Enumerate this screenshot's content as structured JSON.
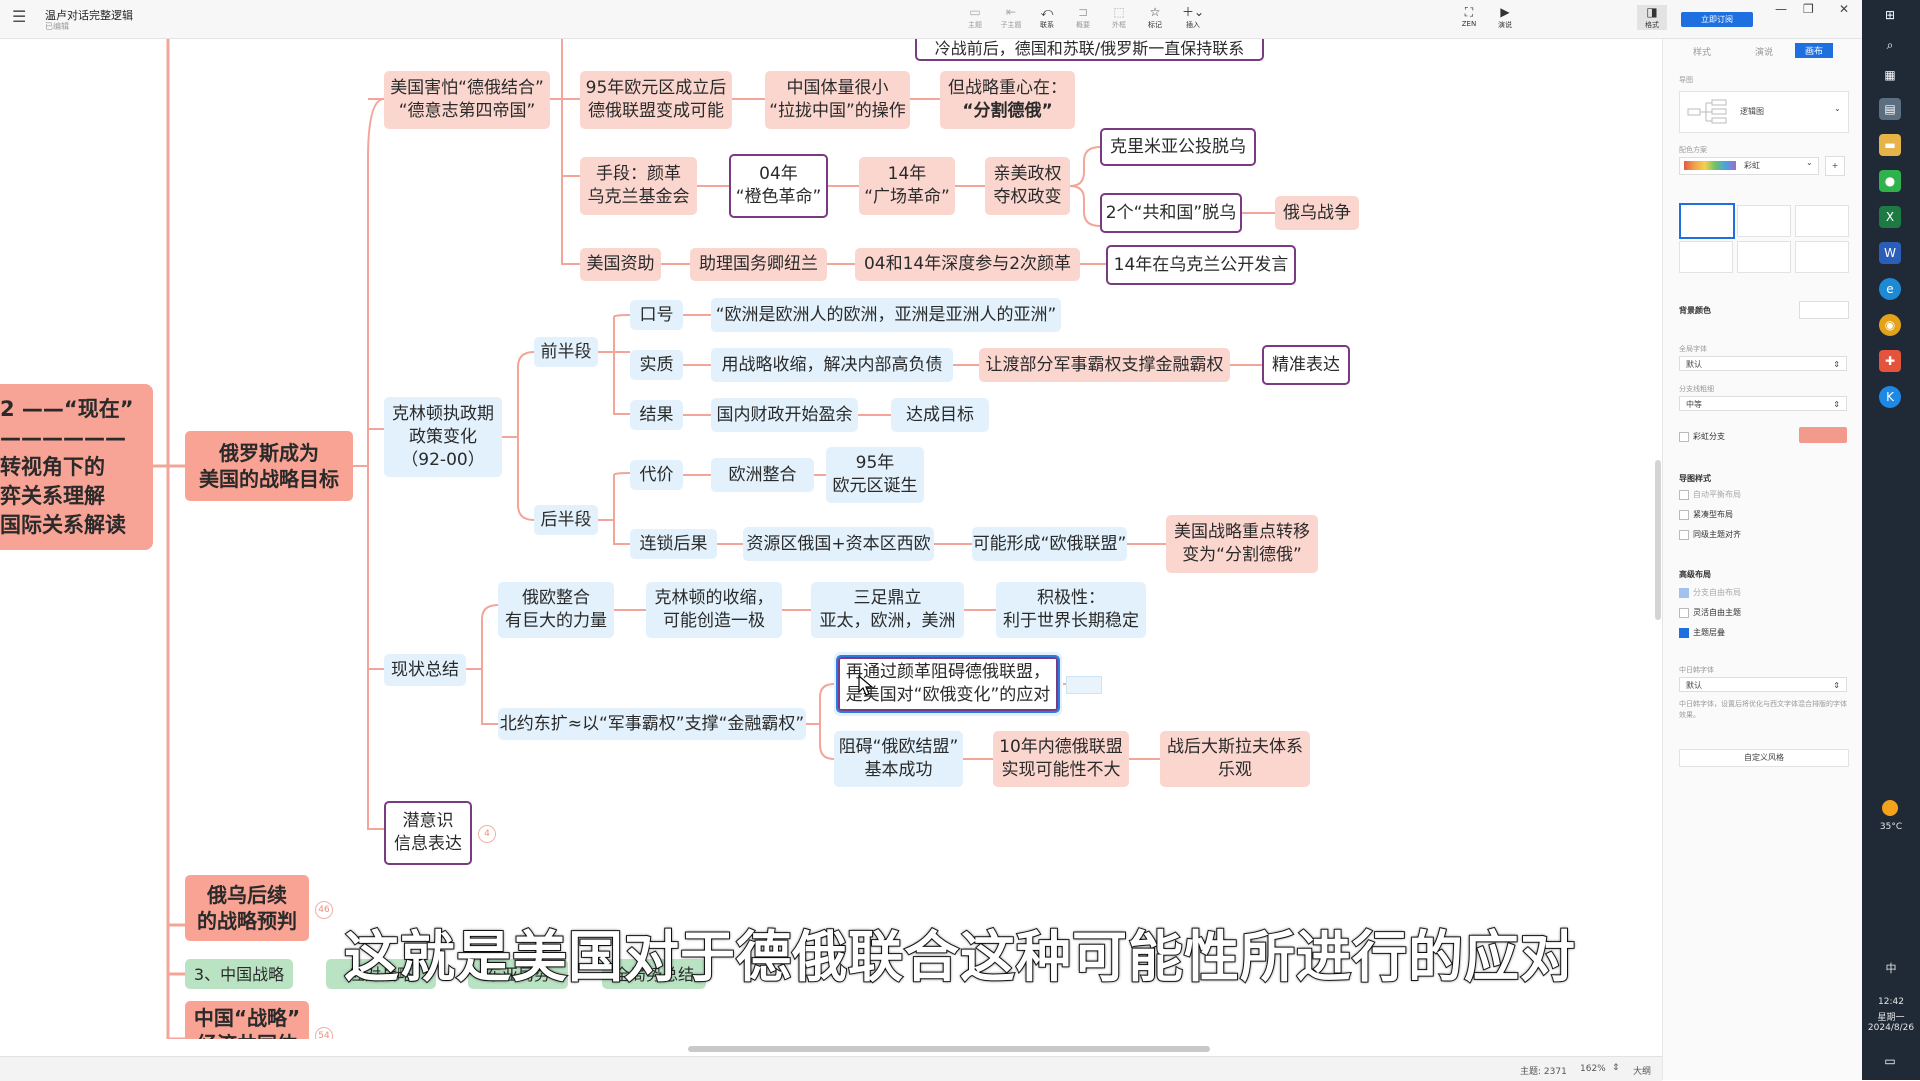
{
  "app": {
    "doc_title": "温卢对话完整逻辑",
    "doc_subtitle": "已编辑",
    "menu_icon": "menu-icon",
    "subscribe_label": "立即订阅"
  },
  "toolbar": {
    "items": [
      {
        "label": "主题",
        "icon": "topic-icon"
      },
      {
        "label": "子主题",
        "icon": "subtopic-icon"
      },
      {
        "label": "联系",
        "icon": "relation-icon"
      },
      {
        "label": "概要",
        "icon": "summary-icon"
      },
      {
        "label": "外框",
        "icon": "boundary-icon"
      },
      {
        "label": "标记",
        "icon": "star-icon"
      },
      {
        "label": "插入",
        "icon": "plus-icon"
      }
    ],
    "zen_label": "ZEN",
    "present_label": "演说",
    "format_label": "格式"
  },
  "mindmap": {
    "root_text": "2 ——“现在”\n——————\n转视角下的\n弈关系理解\n国际关系解读",
    "main_topic": "俄罗斯成为\n美国的战略目标",
    "top_partial": "冷战前后，德国和苏联/俄罗斯一直保持联系",
    "fear_topic": "美国害怕“德俄结合”\n“德意志第四帝国”",
    "euro_node": "95年欧元区成立后\n德俄联盟变成可能",
    "china_node": "中国体量很小\n“拉拢中国”的操作",
    "strategy_line1": "但战略重心在：",
    "strategy_line2": "“分割德俄”",
    "means_node": "手段：颜革\n乌克兰基金会",
    "orange_rev": "04年\n“橙色革命”",
    "square_rev": "14年\n“广场革命”",
    "pro_us": "亲美政权\n夺权政变",
    "crimea": "克里米亚公投脱乌",
    "two_republics": "2个“共和国”脱乌",
    "ru_ua_war": "俄乌战争",
    "us_funding": "美国资助",
    "nuland": "助理国务卿纽兰",
    "deep_involve": "04和14年深度参与2次颜革",
    "speech_ua": "14年在乌克兰公开发言",
    "clinton": "克林顿执政期\n政策变化\n（92-00）",
    "first_half": "前半段",
    "slogan": "口号",
    "slogan_text": "“欧洲是欧洲人的欧洲，亚洲是亚洲人的亚洲”",
    "essence": "实质",
    "essence_text": "用战略收缩，解决内部高负债",
    "yield_text": "让渡部分军事霸权支撑金融霸权",
    "precise": "精准表达",
    "result": "结果",
    "surplus": "国内财政开始盈余",
    "goal_met": "达成目标",
    "second_half": "后半段",
    "cost": "代价",
    "eu_integ": "欧洲整合",
    "euro_born": "95年\n欧元区诞生",
    "chain": "连锁后果",
    "resource": "资源区俄国+资本区西欧",
    "possible_union": "可能形成“欧俄联盟”",
    "shift": "美国战略重点转移\n变为“分割德俄”",
    "status": "现状总结",
    "ru_eu": "俄欧整合\n有巨大的力量",
    "clinton_shrink": "克林顿的收缩，\n可能创造一极",
    "tripod": "三足鼎立\n亚太，欧洲，美洲",
    "positive": "积极性：\n利于世界长期稳定",
    "nato": "北约东扩≈以“军事霸权”支撑“金融霸权”",
    "selected": "再通过颜革阻碍德俄联盟，\n是美国对“欧俄变化”的应对",
    "block": "阻碍“俄欧结盟”\n基本成功",
    "ten_years": "10年内德俄联盟\n实现可能性不大",
    "lavrov": "战后大斯拉夫体系\n乐观",
    "subconscious": "潜意识\n信息表达",
    "count_4": "4",
    "ru_ua_follow": "俄乌后续\n的战略预判",
    "count_46": "46",
    "china_strategy3": "3、中国战略",
    "green_a": "应对战略",
    "green_b": "东亚局势",
    "green_c": "全局势总结",
    "china_war": "中国“战略”\n经济共同体",
    "count_54": "54"
  },
  "subtitle": "这就是美国对于德俄联合这种可能性所进行的应对",
  "statusbar": {
    "topic_count": "主题: 2371",
    "zoom": "162%",
    "outline": "大纲"
  },
  "panel": {
    "tabs": [
      "样式",
      "演说",
      "画布"
    ],
    "structure_label": "导图",
    "structure_value": "逻辑图",
    "color_label": "配色方案",
    "color_value": "彩虹",
    "bg_label": "背景颜色",
    "font_label": "全局字体",
    "font_value": "默认",
    "branch_label": "分支线粗细",
    "branch_value": "中等",
    "rainbow_label": "彩虹分支",
    "map_style_label": "导图样式",
    "opt_auto": "自动平衡布局",
    "opt_compact": "紧凑型布局",
    "opt_align": "同级主题对齐",
    "adv_label": "高级布局",
    "opt_free_branch": "分支自由布局",
    "opt_free_topic": "灵活自由主题",
    "opt_overlap": "主题层叠",
    "cjk_label": "中日韩字体",
    "cjk_value": "默认",
    "cjk_note": "中日韩字体，设置后将优化与西文字体混合排版的字体效果。",
    "custom_style": "自定义风格",
    "accent_color": "#f29b8d"
  },
  "taskbar": {
    "weather": "35°C",
    "time": "12:42",
    "weekday": "星期一",
    "date": "2024/8/26",
    "ime": "中",
    "icons": [
      "windows-icon",
      "search-icon",
      "taskview-icon",
      "app-icon",
      "folder-icon",
      "wechat-icon",
      "excel-icon",
      "word-icon",
      "edge-icon",
      "chrome-icon",
      "xmind-icon",
      "app-k-icon"
    ]
  },
  "colors": {
    "root": "#f7a395",
    "pink": "#fbd6cf",
    "blue": "#e2f1fb",
    "outline": "#7a3a82",
    "branch": "#f2a598",
    "selected": "#2a7be4"
  }
}
